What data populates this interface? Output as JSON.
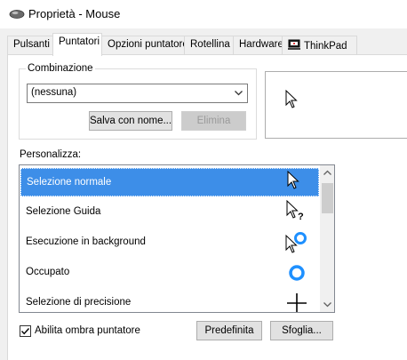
{
  "window": {
    "title": "Proprietà - Mouse",
    "icon": "mouse-icon"
  },
  "tabs": [
    {
      "label": "Pulsanti",
      "active": false
    },
    {
      "label": "Puntatori",
      "active": true
    },
    {
      "label": "Opzioni puntatore",
      "active": false
    },
    {
      "label": "Rotellina",
      "active": false
    },
    {
      "label": "Hardware",
      "active": false
    },
    {
      "label": "ThinkPad",
      "active": false,
      "icon": "thinkpad-icon"
    }
  ],
  "scheme": {
    "group_label": "Combinazione",
    "selected": "(nessuna)",
    "save_button": "Salva con nome...",
    "delete_button": "Elimina"
  },
  "customize": {
    "label": "Personalizza:",
    "items": [
      {
        "label": "Selezione normale",
        "cursor": "arrow-cursor-icon",
        "selected": true
      },
      {
        "label": "Selezione Guida",
        "cursor": "help-cursor-icon",
        "selected": false
      },
      {
        "label": "Esecuzione in background",
        "cursor": "working-background-cursor-icon",
        "selected": false
      },
      {
        "label": "Occupato",
        "cursor": "busy-cursor-icon",
        "selected": false
      },
      {
        "label": "Selezione di precisione",
        "cursor": "crosshair-cursor-icon",
        "selected": false
      }
    ]
  },
  "shadow_checkbox": {
    "label": "Abilita ombra puntatore",
    "checked": true
  },
  "buttons": {
    "default": "Predefinita",
    "browse": "Sfoglia..."
  },
  "colors": {
    "selection": "#3d8ee8",
    "busy_ring": "#1e90ff"
  }
}
